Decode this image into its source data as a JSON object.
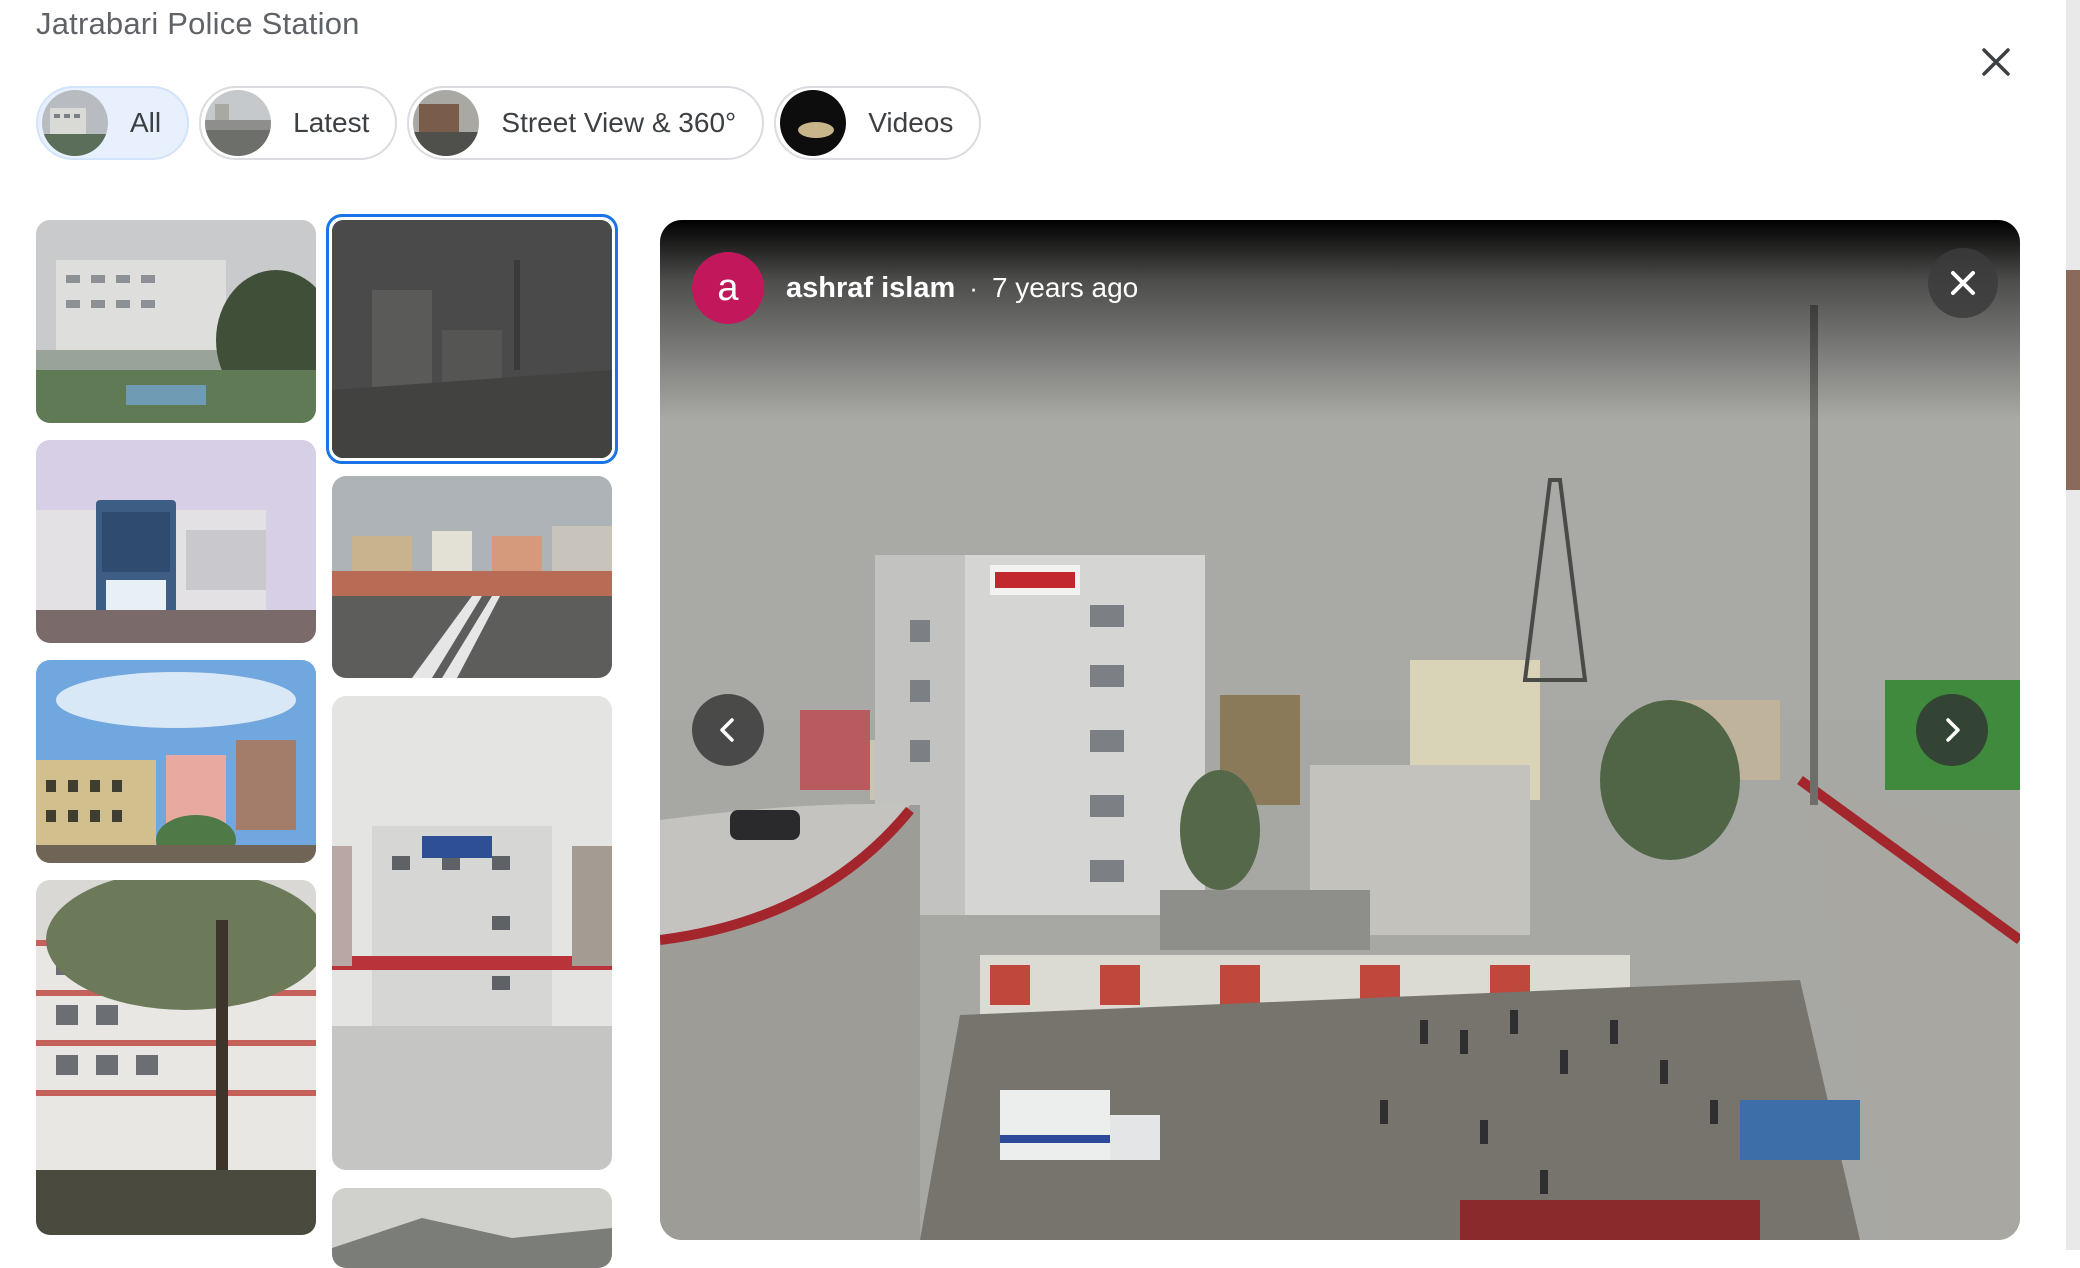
{
  "header": {
    "title": "Jatrabari Police Station"
  },
  "chips": [
    {
      "label": "All",
      "selected": true
    },
    {
      "label": "Latest",
      "selected": false
    },
    {
      "label": "Street View & 360°",
      "selected": false
    },
    {
      "label": "Videos",
      "selected": false
    }
  ],
  "viewer": {
    "author_initial": "a",
    "author_name": "ashraf islam",
    "separator": "·",
    "posted": "7 years ago",
    "avatar_color": "#c2185b"
  },
  "colors": {
    "selected_border": "#1a73e8",
    "selected_chip_bg": "#e8f0fe"
  },
  "icons": [
    "close-icon",
    "chevron-left-icon",
    "chevron-right-icon"
  ]
}
